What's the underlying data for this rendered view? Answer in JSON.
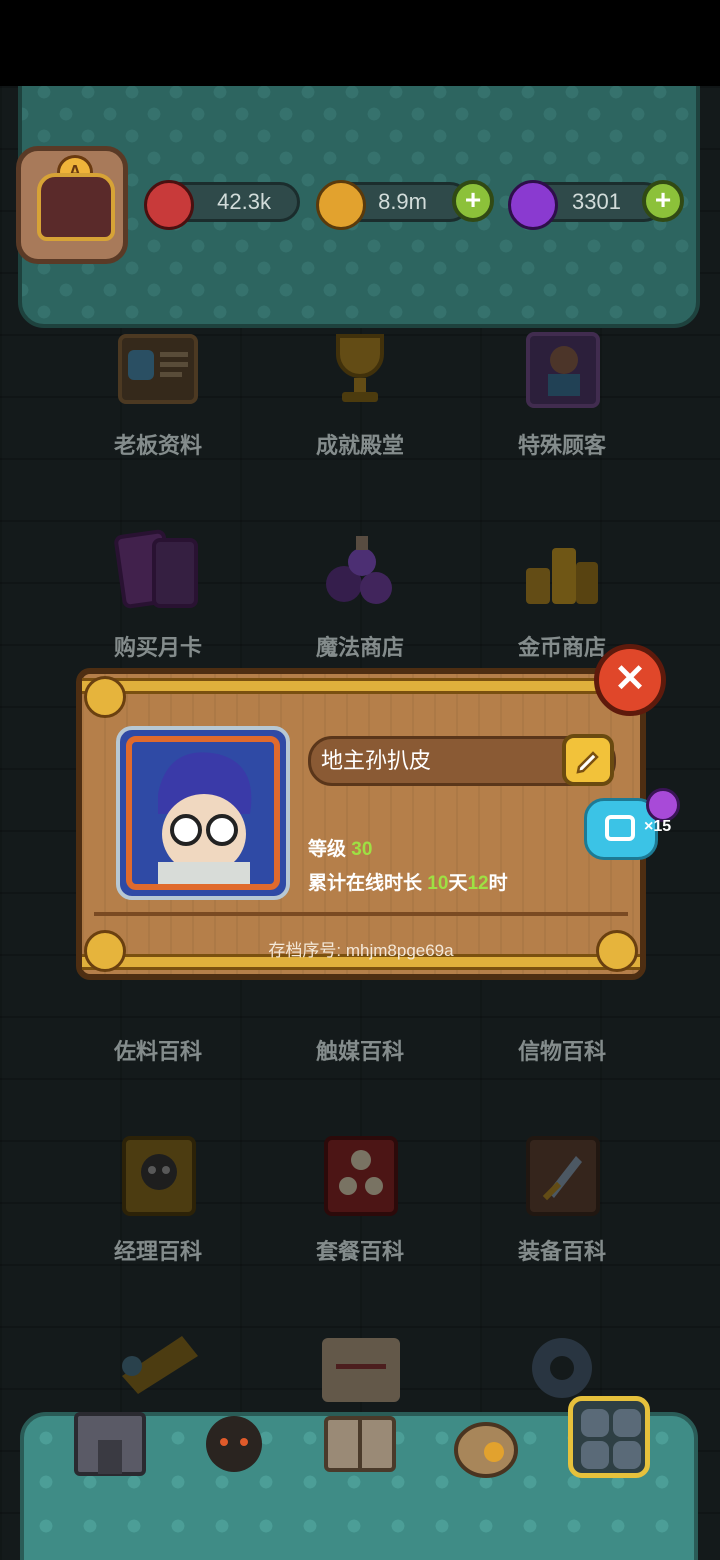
{
  "resources": {
    "eye": "42.3k",
    "coins": "8.9m",
    "potion": "3301"
  },
  "avatar_rank": "A",
  "menu": [
    {
      "label": "老板资料",
      "icon": "boss-profile-icon"
    },
    {
      "label": "成就殿堂",
      "icon": "trophy-icon"
    },
    {
      "label": "特殊顾客",
      "icon": "special-customer-icon"
    },
    {
      "label": "购买月卡",
      "icon": "monthly-card-icon"
    },
    {
      "label": "魔法商店",
      "icon": "magic-shop-icon"
    },
    {
      "label": "金币商店",
      "icon": "gold-shop-icon"
    },
    {
      "label": "佐料百科",
      "icon": "seasoning-book-icon"
    },
    {
      "label": "触媒百科",
      "icon": "catalyst-book-icon"
    },
    {
      "label": "信物百科",
      "icon": "token-book-icon"
    },
    {
      "label": "经理百科",
      "icon": "manager-book-icon"
    },
    {
      "label": "套餐百科",
      "icon": "combo-book-icon"
    },
    {
      "label": "装备百科",
      "icon": "equipment-book-icon"
    }
  ],
  "profile": {
    "name": "地主孙扒皮",
    "level_label": "等级",
    "level": "30",
    "online_label": "累计在线时长",
    "days": "10",
    "days_unit": "天",
    "hours": "12",
    "hours_unit": "时",
    "save_id": "存档序号: mhjm8pge69a",
    "share_reward": "×15"
  },
  "colors": {
    "accent_green": "#9ee043",
    "panel_wood": "#b57f4a",
    "teal": "#3f8c86",
    "close_red": "#e0472a"
  }
}
